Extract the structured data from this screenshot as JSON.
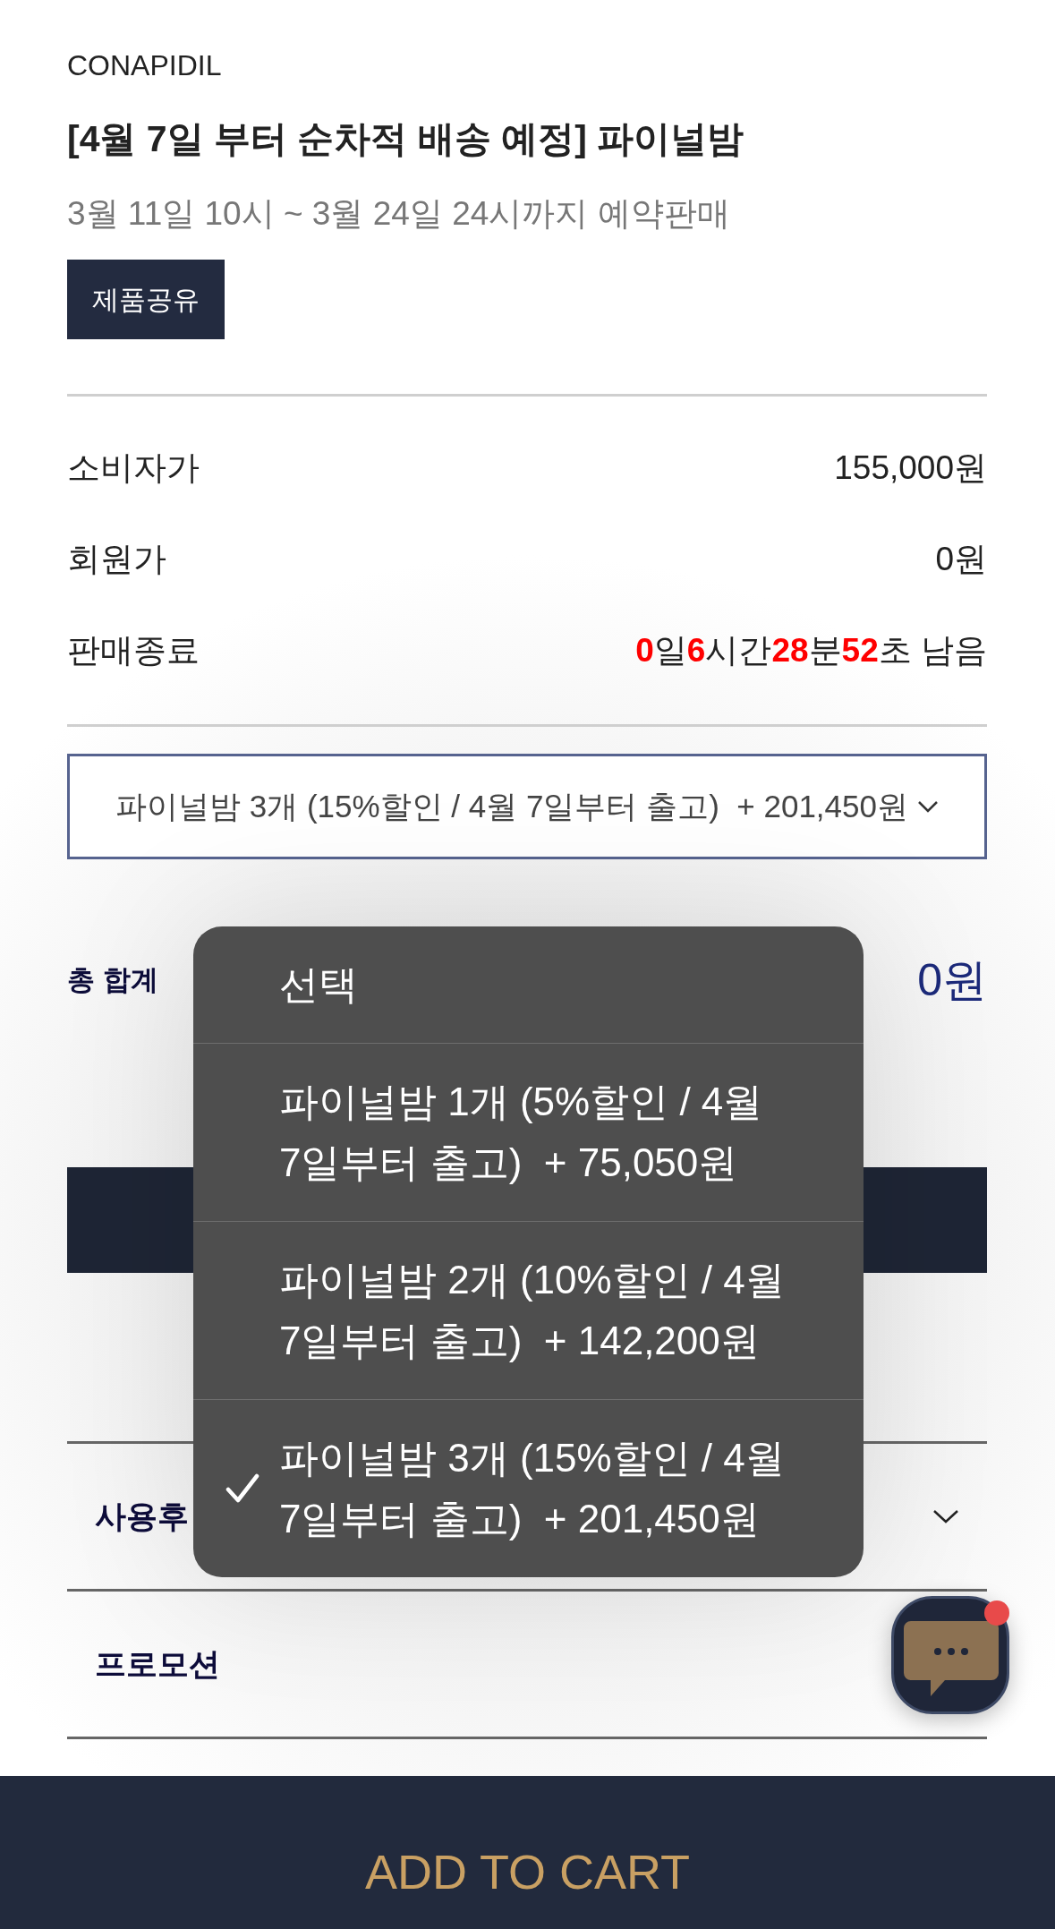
{
  "brand": "CONAPIDIL",
  "title": "[4월 7일 부터 순차적 배송 예정] 파이널밤",
  "subtitle": "3월 11일 10시 ~ 3월 24일 24시까지 예약판매",
  "share_button": "제품공유",
  "price_rows": [
    {
      "label": "소비자가",
      "value": "155,000원"
    },
    {
      "label": "회원가",
      "value": "0원"
    },
    {
      "label": "판매종료",
      "value": "**0**일**6**시간**28**분**52**초 남음"
    }
  ],
  "option_select": {
    "value": "파이널밤 3개 (15%할인 / 4월 7일부터 출고)  + 201,450원"
  },
  "total": {
    "label": "총 합계",
    "value": "0원"
  },
  "option_menu": {
    "items": [
      {
        "label": "선택",
        "selected": false
      },
      {
        "label": "파이널밤 1개 (5%할인 / 4월 7일부터 출고)  + 75,050원",
        "selected": false
      },
      {
        "label": "파이널밤 2개 (10%할인 / 4월 7일부터 출고)  + 142,200원",
        "selected": false
      },
      {
        "label": "파이널밤 3개 (15%할인 / 4월 7일부터 출고)  + 201,450원",
        "selected": true
      }
    ]
  },
  "accordion": [
    {
      "label": "사용후",
      "expanded": false
    },
    {
      "label": "프로모션"
    }
  ],
  "chat": {
    "unread": true
  },
  "cart_button": "ADD TO CART"
}
